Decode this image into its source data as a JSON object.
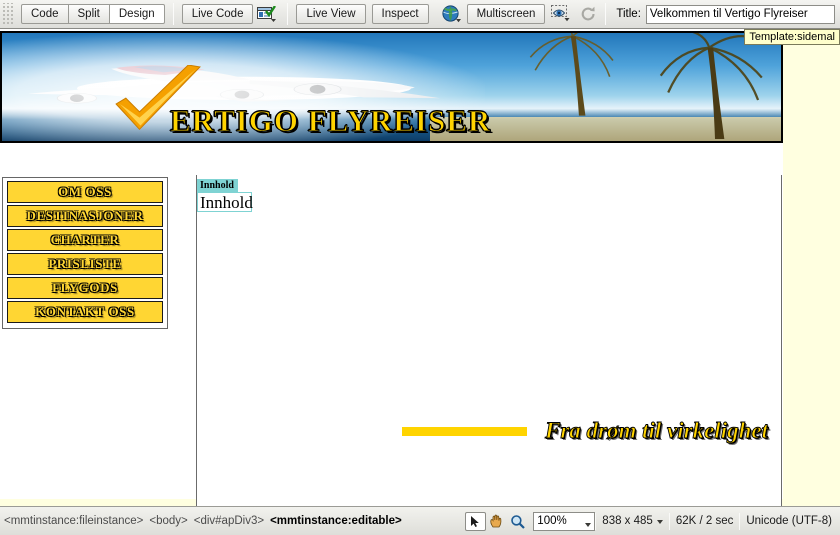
{
  "toolbar": {
    "view_modes": [
      {
        "label": "Code",
        "active": false
      },
      {
        "label": "Split",
        "active": false
      },
      {
        "label": "Design",
        "active": true
      }
    ],
    "live_code_label": "Live Code",
    "live_code_options_icon": "live-code-options-icon",
    "live_view_label": "Live View",
    "inspect_label": "Inspect",
    "browser_preview_icon": "globe-icon",
    "multiscreen_label": "Multiscreen",
    "visual_aids_icon": "eye-icon",
    "refresh_icon": "refresh-icon",
    "title_label": "Title:",
    "title_value": "Velkommen til Vertigo Flyreiser",
    "title_placeholder": "Untitled Document"
  },
  "document": {
    "template_badge": "Template:sidemal",
    "banner": {
      "heading": "ERTIGO FLYREISER",
      "checkmark_icon": "checkmark-icon",
      "alt": "airplane over tropical beach"
    },
    "nav": {
      "items": [
        {
          "label": "OM OSS"
        },
        {
          "label": "DESTINASJONER"
        },
        {
          "label": "CHARTER"
        },
        {
          "label": "PRISLISTE"
        },
        {
          "label": "FLYGODS"
        },
        {
          "label": "KONTAKT OSS"
        }
      ]
    },
    "editable_region": {
      "tab_label": "Innhold",
      "text": "Innhold"
    },
    "slogan": "Fra drøm til virkelighet"
  },
  "statusbar": {
    "tag_selector": [
      {
        "label": "<mmtinstance:fileinstance>",
        "current": false
      },
      {
        "label": "<body>",
        "current": false
      },
      {
        "label": "<div#apDiv3>",
        "current": false
      },
      {
        "label": "<mmtinstance:editable>",
        "current": true
      }
    ],
    "tools": [
      {
        "icon": "select-arrow-icon",
        "selected": true
      },
      {
        "icon": "hand-icon",
        "selected": false
      },
      {
        "icon": "zoom-magnifier-icon",
        "selected": false
      }
    ],
    "zoom_value": "100%",
    "window_size": "838 x 485",
    "download_size": "62K / 2 sec",
    "encoding": "Unicode (UTF-8)"
  },
  "colors": {
    "brand_yellow": "#ffd400",
    "nav_yellow": "#ffd633",
    "editable_teal": "#7fd3d3",
    "page_bg": "#ffffe0"
  }
}
